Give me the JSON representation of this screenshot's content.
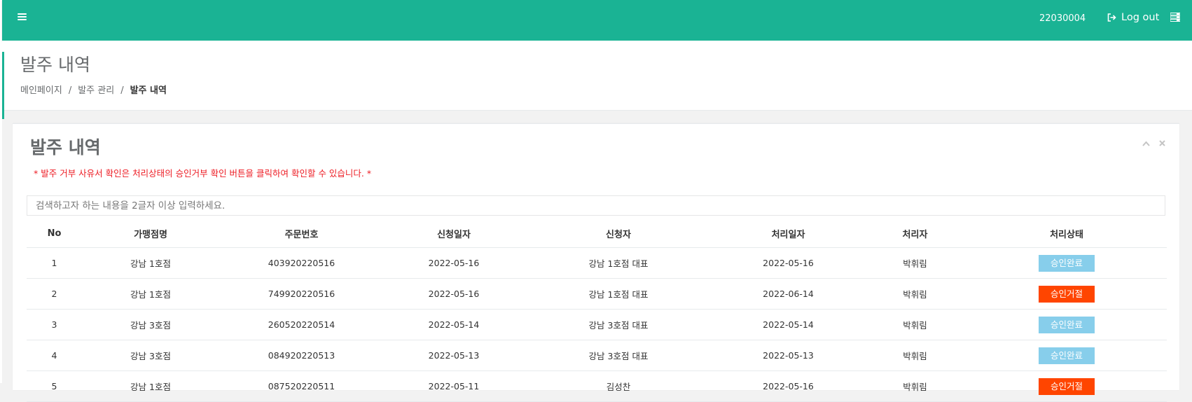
{
  "header": {
    "user_id": "22030004",
    "logout_label": "Log out"
  },
  "page": {
    "title": "발주 내역",
    "breadcrumb": [
      "메인페이지",
      "발주 관리",
      "발주 내역"
    ]
  },
  "panel": {
    "title": "발주 내역",
    "notice": "* 발주 거부 사유서 확인은 처리상태의 승인거부 확인 버튼을 클릭하여 확인할 수 있습니다. *",
    "search_placeholder": "검색하고자 하는 내용을 2글자 이상 입력하세요."
  },
  "table": {
    "columns": [
      "No",
      "가맹점명",
      "주문번호",
      "신청일자",
      "신청자",
      "처리일자",
      "처리자",
      "처리상태"
    ],
    "rows": [
      {
        "no": "1",
        "store": "강남 1호점",
        "order": "403920220516",
        "req_date": "2022-05-16",
        "requester": "강남 1호점 대표",
        "proc_date": "2022-05-16",
        "handler": "박휘림",
        "status": "승인완료",
        "status_color": "#87ceeb"
      },
      {
        "no": "2",
        "store": "강남 1호점",
        "order": "749920220516",
        "req_date": "2022-05-16",
        "requester": "강남 1호점 대표",
        "proc_date": "2022-06-14",
        "handler": "박휘림",
        "status": "승인거절",
        "status_color": "#ff4500"
      },
      {
        "no": "3",
        "store": "강남 3호점",
        "order": "260520220514",
        "req_date": "2022-05-14",
        "requester": "강남 3호점 대표",
        "proc_date": "2022-05-14",
        "handler": "박휘림",
        "status": "승인완료",
        "status_color": "#87ceeb"
      },
      {
        "no": "4",
        "store": "강남 3호점",
        "order": "084920220513",
        "req_date": "2022-05-13",
        "requester": "강남 3호점 대표",
        "proc_date": "2022-05-13",
        "handler": "박휘림",
        "status": "승인완료",
        "status_color": "#87ceeb"
      },
      {
        "no": "5",
        "store": "강남 1호점",
        "order": "087520220511",
        "req_date": "2022-05-11",
        "requester": "김성찬",
        "proc_date": "2022-05-16",
        "handler": "박휘림",
        "status": "승인거절",
        "status_color": "#ff4500"
      }
    ]
  },
  "colors": {
    "brand": "#1ab394",
    "approved": "#87ceeb",
    "rejected": "#ff4500",
    "notice": "#ed1c24"
  },
  "icons": [
    "hamburger-icon",
    "sign-out-icon",
    "tasks-icon",
    "chevron-up-icon",
    "close-icon"
  ]
}
